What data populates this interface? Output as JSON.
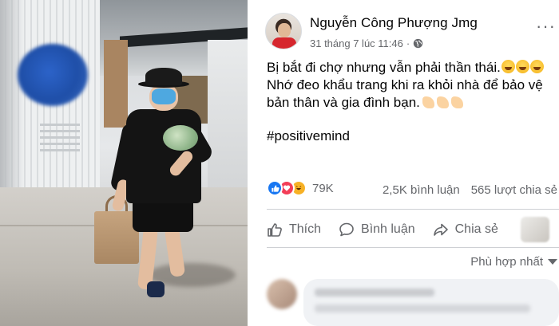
{
  "photo": {
    "alt": "Người đàn ông đeo khẩu trang đi chợ trong trung tâm thương mại"
  },
  "post": {
    "author": "Nguyễn Công Phượng Jmg",
    "timestamp": "31 tháng 7 lúc 11:46",
    "audience_icon": "globe-icon",
    "more_label": "···",
    "lines": [
      "Bị bắt đi chợ nhưng vẫn phải thần thái.",
      "Nhớ đeo khẩu trang khi ra khỏi nhà để bảo vệ",
      "bản thân và gia đình bạn."
    ],
    "hashtag": "#positivemind"
  },
  "reactions": {
    "icons": [
      "like-reaction-icon",
      "love-reaction-icon",
      "haha-reaction-icon"
    ],
    "count": "79K",
    "comments": "2,5K bình luận",
    "shares": "565 lượt chia sẻ"
  },
  "actions": {
    "like": "Thích",
    "comment": "Bình luận",
    "share": "Chia sẻ"
  },
  "sort": {
    "label": "Phù hợp nhất"
  },
  "colors": {
    "like": "#1877f2",
    "love": "#f33e58",
    "haha": "#f7b125",
    "secondary_text": "#65676b",
    "divider": "#ced0d4"
  }
}
